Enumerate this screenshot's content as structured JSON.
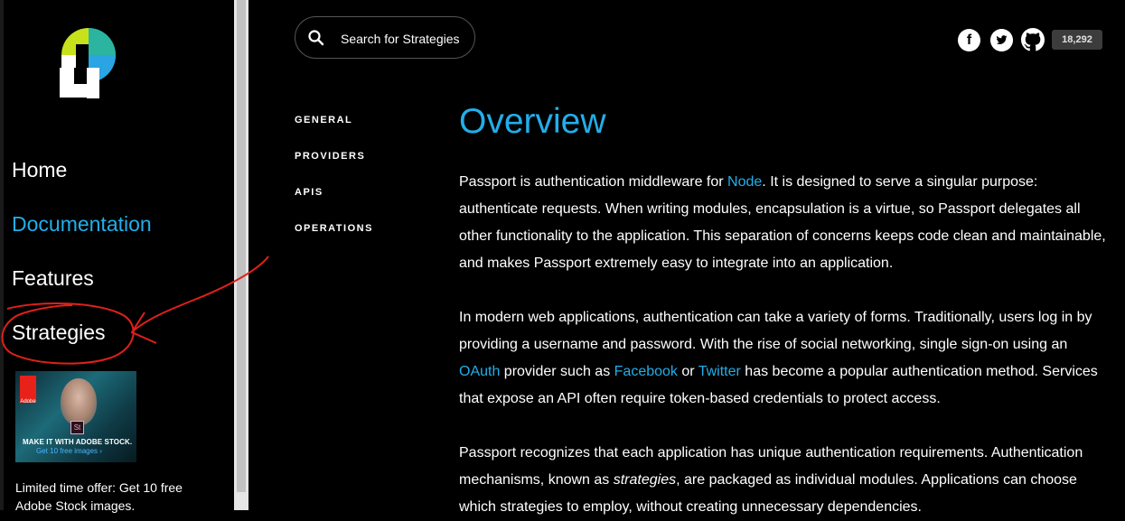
{
  "sidebar": {
    "items": [
      {
        "label": "Home"
      },
      {
        "label": "Documentation"
      },
      {
        "label": "Features"
      },
      {
        "label": "Strategies"
      }
    ],
    "ad": {
      "brand": "Adobe",
      "badge": "St",
      "headline": "MAKE IT WITH ADOBE STOCK.",
      "cta": "Get 10 free images ›"
    },
    "offer_text": "Limited time offer: Get 10 free Adobe Stock images."
  },
  "search": {
    "placeholder": "Search for Strategies"
  },
  "social": {
    "facebook": "f",
    "github_stars": "18,292"
  },
  "toc": [
    "GENERAL",
    "PROVIDERS",
    "APIS",
    "OPERATIONS"
  ],
  "content": {
    "title": "Overview",
    "p1": {
      "a": "Passport is authentication middleware for ",
      "link": "Node",
      "b": ". It is designed to serve a singular purpose: authenticate requests. When writing modules, encapsulation is a virtue, so Passport delegates all other functionality to the application. This separation of concerns keeps code clean and maintainable, and makes Passport extremely easy to integrate into an application."
    },
    "p2": {
      "a": "In modern web applications, authentication can take a variety of forms. Traditionally, users log in by providing a username and password. With the rise of social networking, single sign-on using an ",
      "link1": "OAuth",
      "b": " provider such as ",
      "link2": "Facebook",
      "c": " or ",
      "link3": "Twitter",
      "d": " has become a popular authentication method. Services that expose an API often require token-based credentials to protect access."
    },
    "p3": {
      "a": "Passport recognizes that each application has unique authentication requirements. Authentication mechanisms, known as ",
      "em": "strategies",
      "b": ", are packaged as individual modules. Applications can choose which strategies to employ, without creating unnecessary dependencies."
    }
  },
  "colors": {
    "accent": "#22aeea",
    "background": "#000000",
    "annotation": "#e0201a"
  },
  "icons": [
    "passport-logo",
    "search-icon",
    "facebook-icon",
    "twitter-icon",
    "github-icon"
  ]
}
